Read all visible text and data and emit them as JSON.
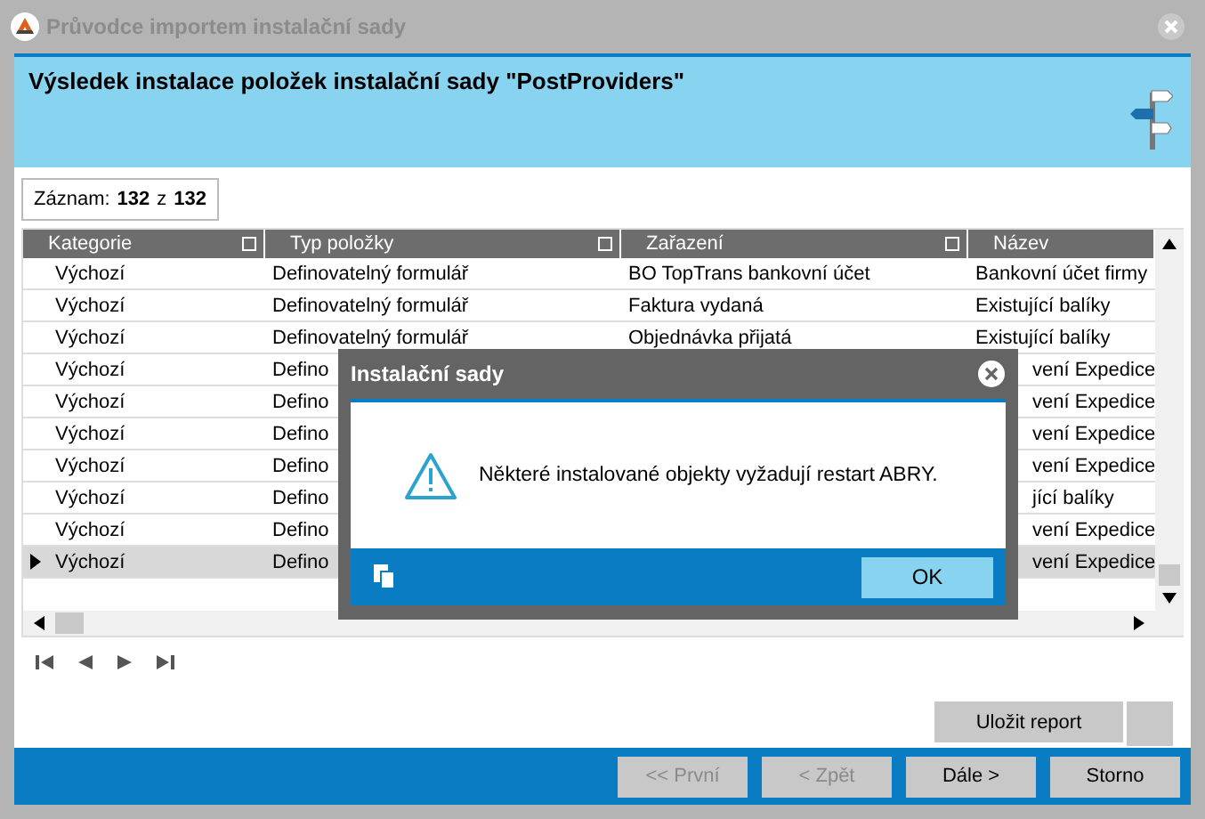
{
  "window": {
    "title": "Průvodce importem instalační sady"
  },
  "header": {
    "title": "Výsledek instalace položek instalační sady \"PostProviders\""
  },
  "record": {
    "label": "Záznam:",
    "current": "132",
    "separator": "z",
    "total": "132"
  },
  "table": {
    "columns": [
      {
        "label": "Kategorie",
        "filter": true
      },
      {
        "label": "Typ položky",
        "filter": true
      },
      {
        "label": "Zařazení",
        "filter": true
      },
      {
        "label": "Název",
        "filter": false
      }
    ],
    "rows": [
      {
        "cells": [
          "Výchozí",
          "Definovatelný formulář",
          "BO TopTrans bankovní účet",
          "Bankovní účet firmy"
        ],
        "selected": false,
        "covered": false
      },
      {
        "cells": [
          "Výchozí",
          "Definovatelný formulář",
          "Faktura vydaná",
          "Existující balíky"
        ],
        "selected": false,
        "covered": false
      },
      {
        "cells": [
          "Výchozí",
          "Definovatelný formulář",
          "Objednávka přijatá",
          "Existující balíky"
        ],
        "selected": false,
        "covered": false
      },
      {
        "cells": [
          "Výchozí",
          "Defino",
          "",
          "vení Expedice"
        ],
        "selected": false,
        "covered": true
      },
      {
        "cells": [
          "Výchozí",
          "Defino",
          "",
          "vení Expedice"
        ],
        "selected": false,
        "covered": true
      },
      {
        "cells": [
          "Výchozí",
          "Defino",
          "",
          "vení Expedice"
        ],
        "selected": false,
        "covered": true
      },
      {
        "cells": [
          "Výchozí",
          "Defino",
          "",
          "vení Expedice"
        ],
        "selected": false,
        "covered": true
      },
      {
        "cells": [
          "Výchozí",
          "Defino",
          "",
          "jící balíky"
        ],
        "selected": false,
        "covered": true
      },
      {
        "cells": [
          "Výchozí",
          "Defino",
          "",
          "vení Expedice"
        ],
        "selected": false,
        "covered": true
      },
      {
        "cells": [
          "Výchozí",
          "Defino",
          "",
          "vení Expedice"
        ],
        "selected": true,
        "covered": true
      }
    ]
  },
  "actions": {
    "save_report": "Uložit report"
  },
  "footer_buttons": [
    {
      "label": "<< První",
      "disabled": true
    },
    {
      "label": "< Zpět",
      "disabled": true
    },
    {
      "label": "Dále >",
      "disabled": false
    },
    {
      "label": "Storno",
      "disabled": false
    }
  ],
  "dialog": {
    "title": "Instalační sady",
    "message": "Některé instalované objekty vyžadují restart ABRY.",
    "ok": "OK"
  }
}
